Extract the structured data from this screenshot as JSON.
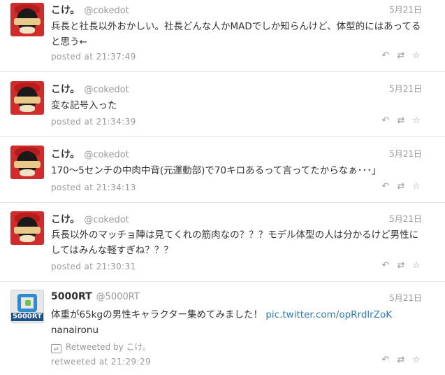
{
  "tweets": [
    {
      "name": "こけ。",
      "handle": "@cokedot",
      "date": "5月21日",
      "text": "兵長と社長以外おかしい。社長どんな人かMADでしか知らんけど、体型的にはあってると思う←",
      "meta": "posted at 21:37:49",
      "avatar": "coke"
    },
    {
      "name": "こけ。",
      "handle": "@cokedot",
      "date": "5月21日",
      "text": "変な記号入った",
      "meta": "posted at 21:34:39",
      "avatar": "coke"
    },
    {
      "name": "こけ。",
      "handle": "@cokedot",
      "date": "5月21日",
      "text": "170～5センチの中肉中背(元運動部)で70キロあるって言ってたからなぁ･･･」",
      "meta": "posted at 21:34:13",
      "avatar": "coke"
    },
    {
      "name": "こけ。",
      "handle": "@cokedot",
      "date": "5月21日",
      "text": "兵長以外のマッチョ陣は見てくれの筋肉なの？？？モデル体型の人は分かるけど男性にしてはみんな軽すぎね？？？",
      "meta": "posted at 21:30:31",
      "avatar": "coke"
    },
    {
      "name": "5000RT",
      "handle": "@5000RT",
      "date": "5月21日",
      "text": "体重が65kgの男性キャラクター集めてみました！ ",
      "link": "pic.twitter.com/opRrdlrZoK",
      "text_tail": " nanaironu",
      "retweeted_by": "Retweeted by こけ。",
      "meta": "retweeted at 21:29:29",
      "avatar": "rt",
      "avatar_label": "5000RT"
    }
  ],
  "icons": {
    "reply": "↶",
    "retweet": "⇄",
    "favorite": "☆"
  }
}
